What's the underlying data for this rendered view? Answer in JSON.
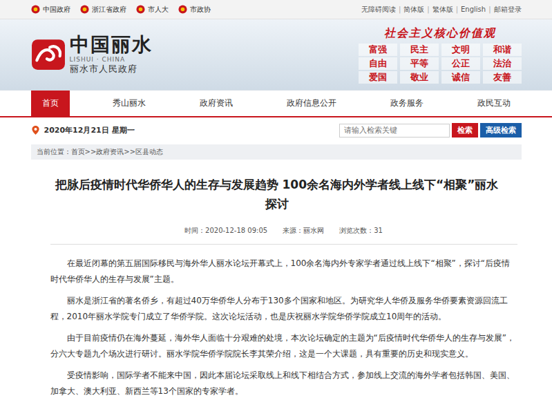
{
  "top_bar": {
    "links": [
      {
        "label": "中国政府"
      },
      {
        "label": "浙江省政府"
      },
      {
        "label": "市人大"
      },
      {
        "label": "市政协"
      }
    ],
    "utilities": [
      "无障碍阅读",
      "简体版",
      "繁体版",
      "English",
      "邮箱登录"
    ],
    "separator": "|"
  },
  "header": {
    "logo_title": "中国丽水",
    "logo_subtitle": "LISHUI · CHINA",
    "logo_caption": "丽水市人民政府",
    "slogan": "社会主义核心价值观",
    "values": [
      "富强",
      "民主",
      "文明",
      "和谐",
      "自由",
      "平等",
      "公正",
      "法治",
      "爱国",
      "敬业",
      "诚信",
      "友善"
    ]
  },
  "nav": [
    {
      "label": "首页",
      "selected": true
    },
    {
      "label": "秀山丽水",
      "selected": false
    },
    {
      "label": "政府资讯",
      "selected": false
    },
    {
      "label": "政府信息公开",
      "selected": false
    },
    {
      "label": "政务服务",
      "selected": false
    },
    {
      "label": "政民互动",
      "selected": false
    }
  ],
  "date": "2020年12月21日 星期一",
  "search": {
    "placeholder": "请输入检索关键",
    "button": "检索",
    "advanced": "高级检索"
  },
  "breadcrumb": {
    "label": "当前位置：",
    "items": [
      "首页",
      "政府资讯",
      "区县动态"
    ],
    "separator": ">>"
  },
  "article": {
    "title": "把脉后疫情时代华侨华人的生存与发展趋势 100余名海内外学者线上线下“相聚”丽水探讨",
    "meta": [
      {
        "label": "时间：",
        "value": "2020-12-18 09:05"
      },
      {
        "label": "来源：",
        "value": "丽水网"
      },
      {
        "label": "浏览次数：",
        "value": "31"
      }
    ],
    "paragraphs": [
      "在最近闭幕的第五届国际移民与海外华人丽水论坛开幕式上，100余名海内外专家学者通过线上线下“相聚”，探讨“后疫情时代华侨华人的生存与发展”主题。",
      "丽水是浙江省的著名侨乡，有超过40万华侨华人分布于130多个国家和地区。为研究华人华侨及服务华侨要素资源回流工程，2010年丽水学院专门成立了华侨学院。这次论坛活动，也是庆祝丽水学院华侨学院成立10周年的活动。",
      "由于目前疫情仍在海外蔓延，海外华人面临十分艰难的处境，本次论坛确定的主题为“后疫情时代华侨华人的生存与发展”，分六大专题九个场次进行研讨。丽水学院华侨学院院长李其荣介绍，这是一个大课题，具有重要的历史和现实意义。",
      "受疫情影响，国际学者不能来中国，因此本届论坛采取线上和线下相结合方式，参加线上交流的海外学者包括韩国、美国、加拿大、澳大利亚、新西兰等13个国家的专家学者。"
    ]
  }
}
